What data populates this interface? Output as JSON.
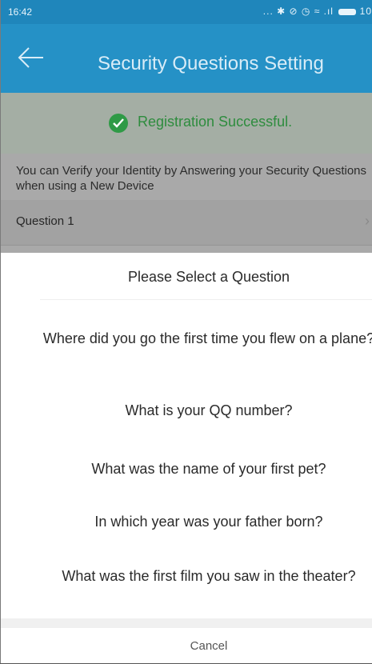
{
  "status_bar": {
    "time": "16:42",
    "icons_text": "... ✱ ⊘ ◷ ≈ .ıl",
    "battery": "10"
  },
  "app_bar": {
    "title": "Security Questions Setting",
    "back_icon": "arrow-left-icon"
  },
  "banner": {
    "text": "Registration Successful.",
    "icon": "check-circle-icon",
    "color": "#2e8c3e"
  },
  "info_text": "You can Verify your Identity by Answering your Security Questions when using a New Device",
  "question_row": {
    "label": "Question 1",
    "chevron": "chevron-right-icon"
  },
  "sheet": {
    "title": "Please Select a Question",
    "options": [
      "Where did you go the first time you flew on a plane?",
      "What is your QQ number?",
      "What was the name of your first pet?",
      "In which year was your father born?",
      "What was the first film you saw in the theater?"
    ],
    "cancel": "Cancel"
  },
  "colors": {
    "accent": "#2591c6",
    "status_bar": "#1f86bb",
    "success_green": "#2f9a46"
  }
}
